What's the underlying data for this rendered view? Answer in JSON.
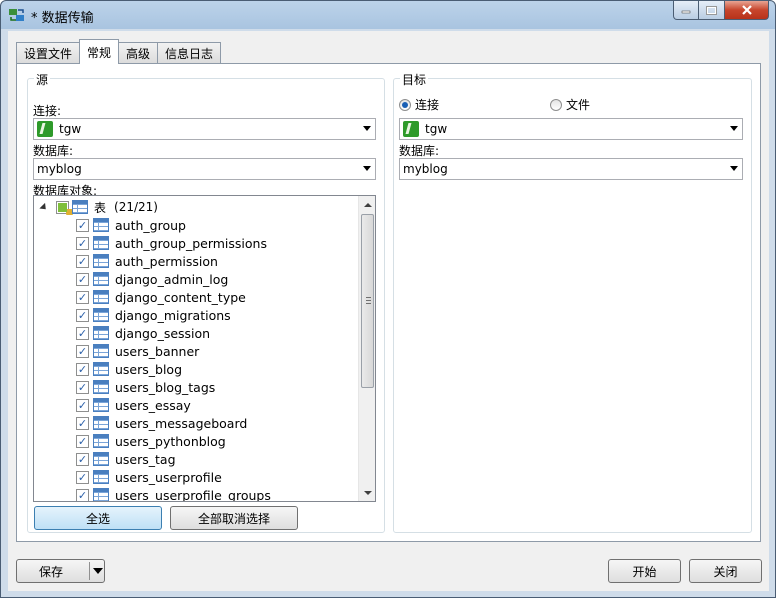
{
  "window": {
    "title": "* 数据传输"
  },
  "tabs": [
    {
      "label": "设置文件",
      "active": false
    },
    {
      "label": "常规",
      "active": true
    },
    {
      "label": "高级",
      "active": false
    },
    {
      "label": "信息日志",
      "active": false
    }
  ],
  "source": {
    "group_title": "源",
    "connection_label": "连接:",
    "connection_value": "tgw",
    "database_label": "数据库:",
    "database_value": "myblog",
    "objects_label": "数据库对象:",
    "tree": {
      "root_label": "表",
      "root_count": "(21/21)",
      "tables": [
        "auth_group",
        "auth_group_permissions",
        "auth_permission",
        "django_admin_log",
        "django_content_type",
        "django_migrations",
        "django_session",
        "users_banner",
        "users_blog",
        "users_blog_tags",
        "users_essay",
        "users_messageboard",
        "users_pythonblog",
        "users_tag",
        "users_userprofile",
        "users_userprofile_groups"
      ]
    },
    "select_all_label": "全选",
    "deselect_all_label": "全部取消选择"
  },
  "target": {
    "group_title": "目标",
    "radio_connection_label": "连接",
    "radio_file_label": "文件",
    "selected_mode": "连接",
    "connection_value": "tgw",
    "database_label": "数据库:",
    "database_value": "myblog"
  },
  "footer": {
    "save_label": "保存",
    "start_label": "开始",
    "close_label": "关闭"
  }
}
